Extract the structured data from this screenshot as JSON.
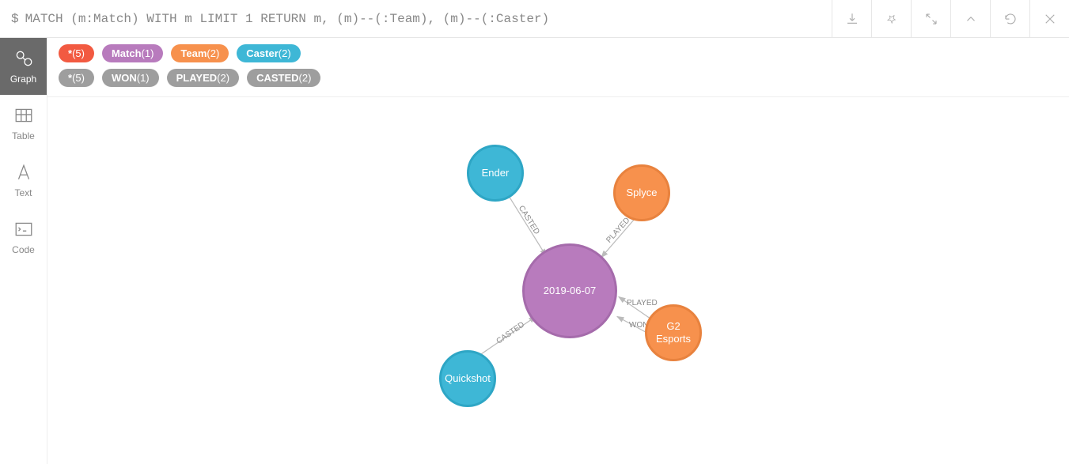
{
  "query": {
    "prompt": "$",
    "text": "MATCH (m:Match) WITH m LIMIT 1 RETURN m, (m)--(:Team), (m)--(:Caster)"
  },
  "sidebar": {
    "tabs": [
      {
        "label": "Graph"
      },
      {
        "label": "Table"
      },
      {
        "label": "Text"
      },
      {
        "label": "Code"
      }
    ]
  },
  "node_pills": [
    {
      "label": "*",
      "count": "(5)",
      "color": "red"
    },
    {
      "label": "Match",
      "count": "(1)",
      "color": "purple"
    },
    {
      "label": "Team",
      "count": "(2)",
      "color": "orange"
    },
    {
      "label": "Caster",
      "count": "(2)",
      "color": "blue"
    }
  ],
  "rel_pills": [
    {
      "label": "*",
      "count": "(5)"
    },
    {
      "label": "WON",
      "count": "(1)"
    },
    {
      "label": "PLAYED",
      "count": "(2)"
    },
    {
      "label": "CASTED",
      "count": "(2)"
    }
  ],
  "graph": {
    "nodes": {
      "match": {
        "label": "2019-06-07"
      },
      "ender": {
        "label": "Ender"
      },
      "quickshot": {
        "label": "Quickshot"
      },
      "splyce": {
        "label": "Splyce"
      },
      "g2": {
        "label": "G2 Esports"
      }
    },
    "edges": {
      "ender_casted": "CASTED",
      "quickshot_casted": "CASTED",
      "splyce_played": "PLAYED",
      "g2_played": "PLAYED",
      "g2_won": "WON"
    }
  }
}
